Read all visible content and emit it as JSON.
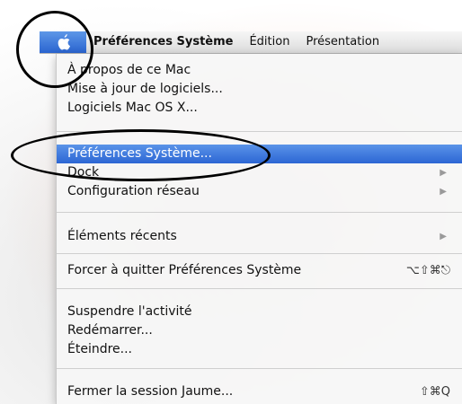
{
  "menubar": {
    "apple_icon": "apple-logo-icon",
    "app_menu": "Préférences Système",
    "edit_menu": "Édition",
    "view_menu": "Présentation"
  },
  "apple_menu": {
    "about": "À propos de ce Mac",
    "software_update": "Mise à jour de logiciels...",
    "mac_os_x_software": "Logiciels Mac OS X...",
    "system_preferences": "Préférences Système...",
    "dock": "Dock",
    "network_configuration": "Configuration réseau",
    "recent_items": "Éléments récents",
    "force_quit": "Forcer à quitter Préférences Système",
    "force_quit_shortcut": "⌥⇧⌘⎋",
    "sleep": "Suspendre l'activité",
    "restart": "Redémarrer...",
    "shut_down": "Éteindre...",
    "log_out": "Fermer la session Jaume...",
    "log_out_shortcut": "⇧⌘Q",
    "submenu_arrow": "▶"
  },
  "colors": {
    "highlight": "#2c66d4",
    "callout": "#000000"
  }
}
